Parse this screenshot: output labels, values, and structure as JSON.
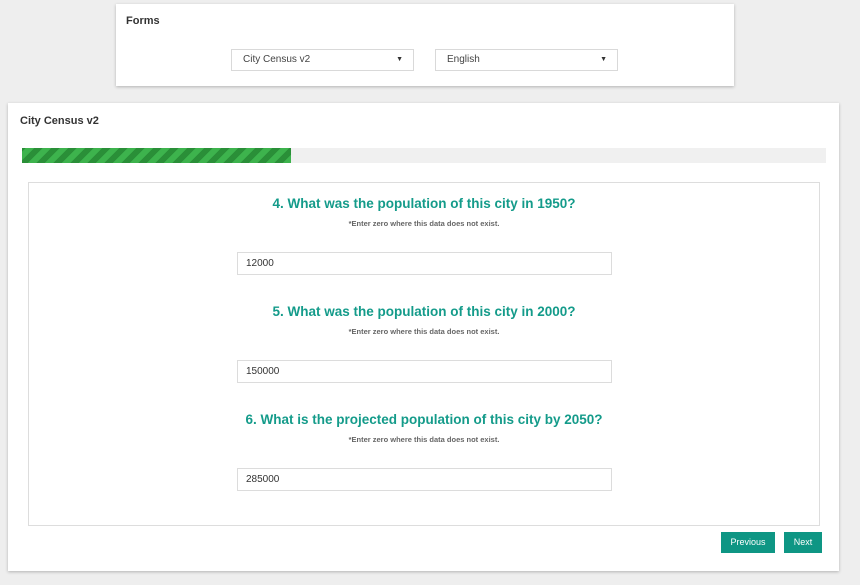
{
  "forms_panel": {
    "title": "Forms",
    "form_select": {
      "value": "City Census v2",
      "caret": "▼"
    },
    "language_select": {
      "value": "English",
      "caret": "▼"
    }
  },
  "survey": {
    "title": "City Census v2",
    "progress_fraction": 0.335,
    "questions": [
      {
        "title": "4. What was the population of this city in 1950?",
        "hint": "*Enter zero where this data does not exist.",
        "value": "12000"
      },
      {
        "title": "5. What was the population of this city in 2000?",
        "hint": "*Enter zero where this data does not exist.",
        "value": "150000"
      },
      {
        "title": "6. What is the projected population of this city by 2050?",
        "hint": "*Enter zero where this data does not exist.",
        "value": "285000"
      }
    ],
    "buttons": {
      "previous": "Previous",
      "next": "Next"
    }
  },
  "colors": {
    "accent": "#0e9684",
    "question_title": "#149b8a",
    "progress": "#3db34d"
  }
}
